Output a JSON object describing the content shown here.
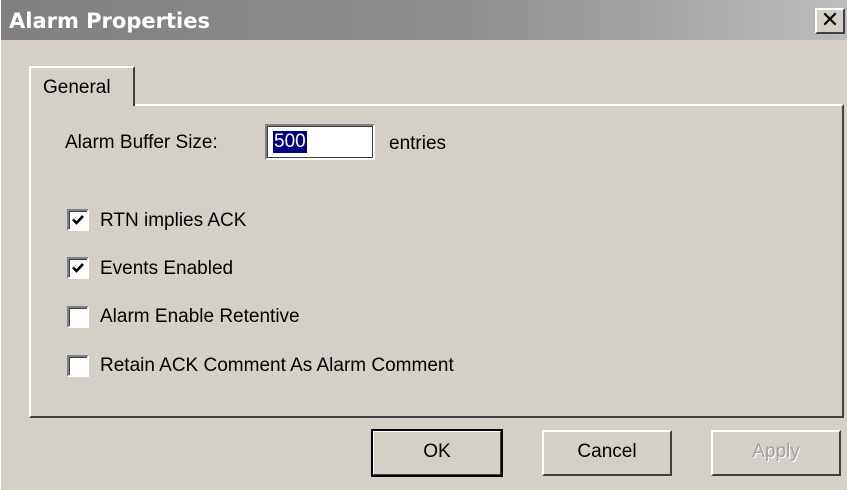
{
  "window": {
    "title": "Alarm Properties",
    "close_label": "✕"
  },
  "tabs": [
    {
      "label": "General",
      "active": true
    }
  ],
  "general": {
    "buffer_label": "Alarm Buffer Size:",
    "buffer_value": "500",
    "buffer_unit": "entries",
    "checkboxes": [
      {
        "label": "RTN implies ACK",
        "checked": true
      },
      {
        "label": "Events Enabled",
        "checked": true
      },
      {
        "label": "Alarm Enable Retentive",
        "checked": false
      },
      {
        "label": "Retain ACK Comment As Alarm Comment",
        "checked": false
      }
    ]
  },
  "buttons": {
    "ok": "OK",
    "cancel": "Cancel",
    "apply": "Apply",
    "apply_enabled": false
  },
  "colors": {
    "face": "#d4d0c8",
    "title_bar": "#808080",
    "selection": "#000080"
  }
}
